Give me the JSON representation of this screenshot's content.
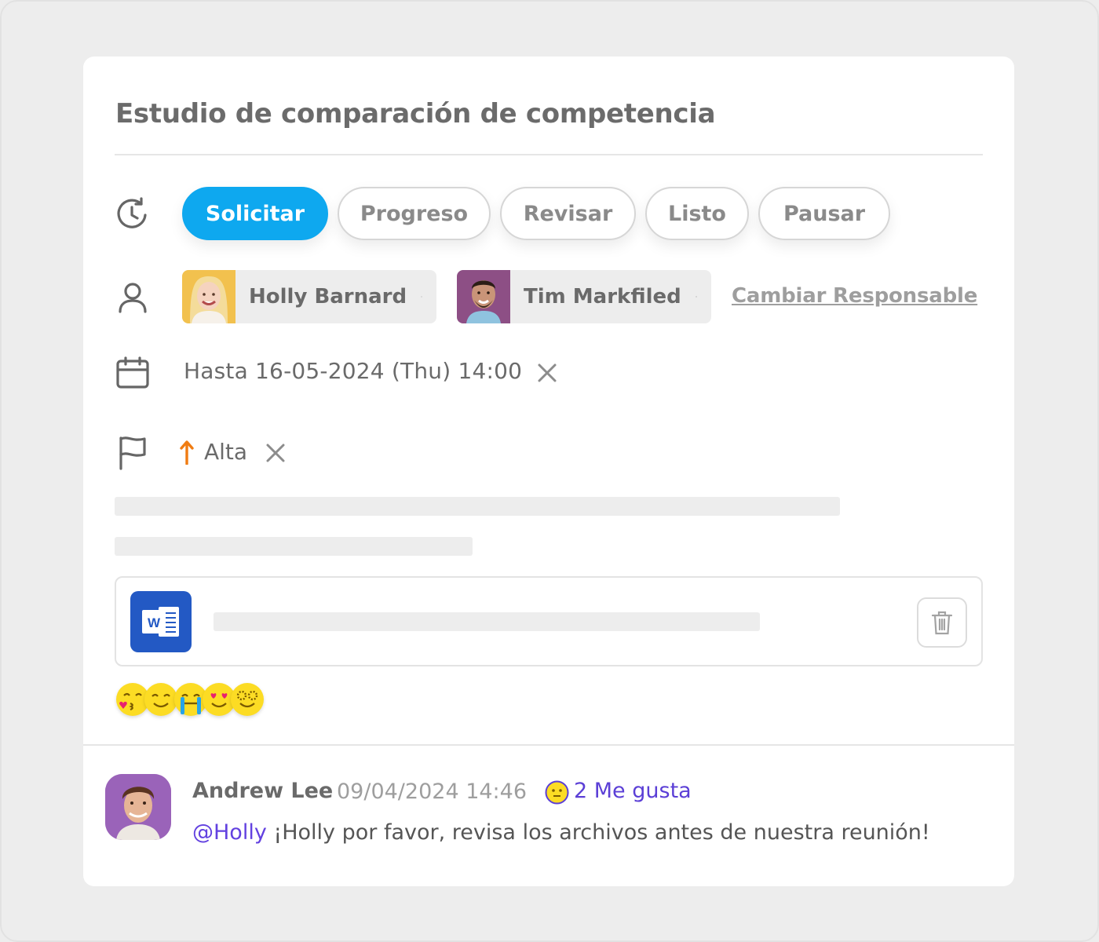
{
  "task": {
    "title": "Estudio de comparación de competencia"
  },
  "status": {
    "options": [
      "Solicitar",
      "Progreso",
      "Revisar",
      "Listo",
      "Pausar"
    ],
    "selected": "Solicitar"
  },
  "assignees": {
    "people": [
      {
        "name": "Holly Barnard"
      },
      {
        "name": "Tim Markfiled"
      }
    ],
    "change_label": "Cambiar Responsable"
  },
  "due": {
    "prefix": "Hasta",
    "date": "16-05-2024",
    "weekday": "(Thu)",
    "time": "14:00"
  },
  "priority": {
    "label": "Alta",
    "color": "#f07c12"
  },
  "attachment": {
    "type_icon": "word-document-icon",
    "accent": "#2359c4"
  },
  "reactions": [
    "kiss-emoji",
    "smile-emoji",
    "laugh-tears-emoji",
    "heart-eyes-emoji",
    "star-eyes-emoji"
  ],
  "comment": {
    "author": "Andrew Lee",
    "timestamp": "09/04/2024 14:46",
    "likes_label": "2 Me gusta",
    "mention": "@Holly",
    "text": "¡Holly por favor, revisa los archivos antes de nuestra reunión!"
  },
  "colors": {
    "accent": "#0ea8ef",
    "mention": "#6241e0"
  }
}
